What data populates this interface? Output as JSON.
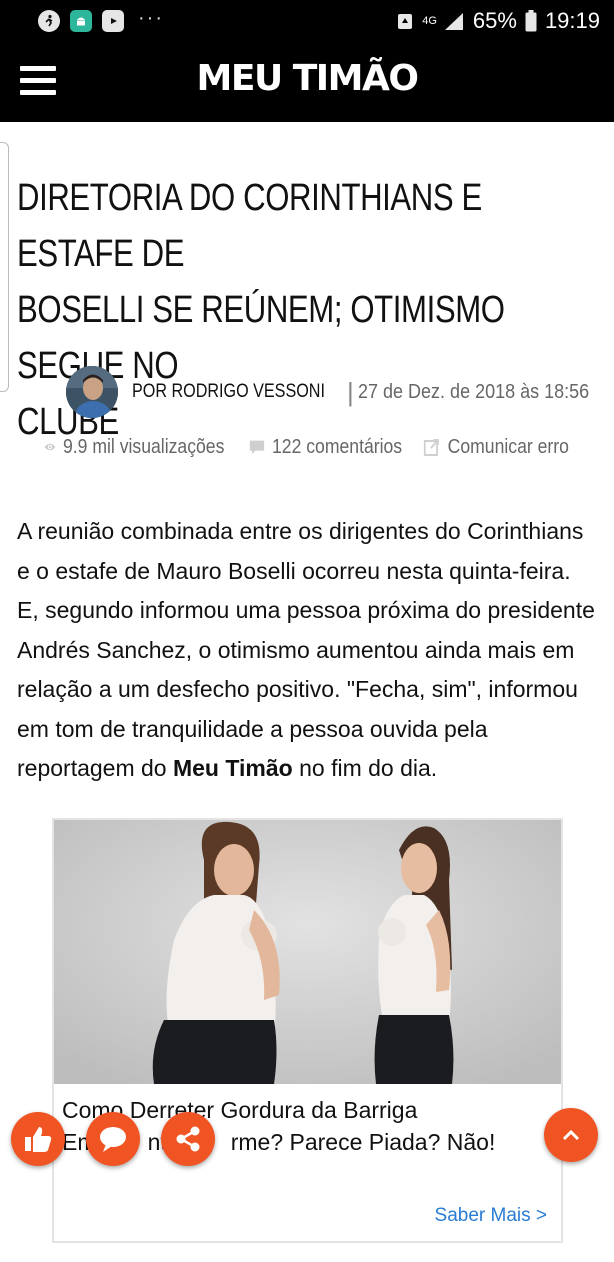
{
  "status_bar": {
    "network": "4G",
    "battery": "65%",
    "time": "19:19",
    "dots": "···",
    "left_icons": [
      "runner-icon",
      "android-icon",
      "youtube-icon"
    ]
  },
  "app_bar": {
    "logo": "MEU TIMÃO",
    "menu_icon": "hamburger-menu-icon"
  },
  "article": {
    "headline_lines": [
      "DIRETORIA DO CORINTHIANS E ESTAFE DE",
      "BOSELLI SE REÚNEM; OTIMISMO SEGUE NO",
      "CLUBE"
    ],
    "author": "POR RODRIGO VESSONI",
    "separator": "|",
    "date": "27 de Dez. de 2018 às 18:56",
    "views": "9.9 mil visualizações",
    "comments": "122 comentários",
    "report": "Comunicar erro",
    "body_lines": [
      "A reunião combinada entre os dirigentes do Corinthians",
      "e o estafe de Mauro Boselli ocorreu nesta quinta-feira.",
      "E, segundo informou uma pessoa próxima do presidente",
      "Andrés Sanchez, o otimismo aumentou ainda mais em",
      "relação a um desfecho positivo. \"Fecha, sim\", informou",
      "em tom de tranquilidade a pessoa ouvida pela"
    ],
    "body_last_prefix": "reportagem do ",
    "body_last_bold": "Meu Timão",
    "body_last_suffix": " no fim do dia."
  },
  "ad": {
    "title_line1": "Como Derreter Gordura da Barriga",
    "title_line2": "Em        nto        rme? Parece Piada? Não!",
    "cta": "Saber Mais >"
  },
  "colors": {
    "accent": "#f05423",
    "header_bg": "#000000",
    "link": "#2a7dd4"
  },
  "fabs": [
    "like-icon",
    "comment-icon",
    "share-icon",
    "chevron-up-icon"
  ]
}
